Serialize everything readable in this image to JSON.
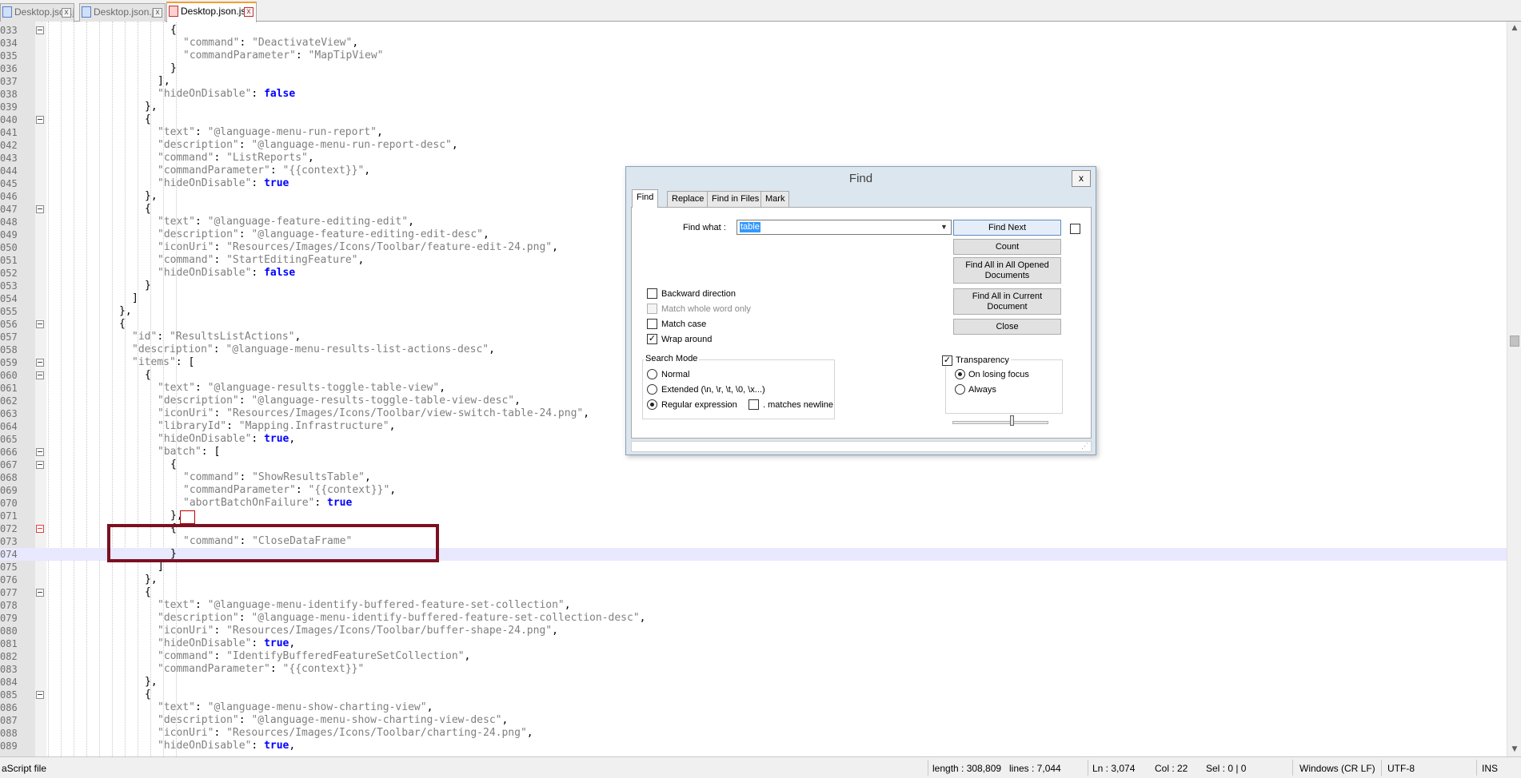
{
  "tabs": [
    {
      "label": "Desktop.json.js",
      "active": false
    },
    {
      "label": "Desktop.json.js",
      "active": false
    },
    {
      "label": "Desktop.json.js",
      "active": true
    }
  ],
  "tab_close_glyph": "x",
  "editor": {
    "current_line": "074",
    "lines": [
      {
        "n": "033",
        "fold": true,
        "parts": [
          {
            "t": "{",
            "c": "p"
          }
        ]
      },
      {
        "n": "034",
        "parts": [
          {
            "t": "\"command\"",
            "c": "s"
          },
          {
            "t": ": ",
            "c": "p"
          },
          {
            "t": "\"DeactivateView\"",
            "c": "s"
          },
          {
            "t": ",",
            "c": "p"
          }
        ]
      },
      {
        "n": "035",
        "parts": [
          {
            "t": "\"commandParameter\"",
            "c": "s"
          },
          {
            "t": ": ",
            "c": "p"
          },
          {
            "t": "\"MapTipView\"",
            "c": "s"
          }
        ]
      },
      {
        "n": "036",
        "parts": [
          {
            "t": "}",
            "c": "p"
          }
        ]
      },
      {
        "n": "037",
        "parts": [
          {
            "t": "],",
            "c": "p"
          }
        ]
      },
      {
        "n": "038",
        "parts": [
          {
            "t": "\"hideOnDisable\"",
            "c": "s"
          },
          {
            "t": ": ",
            "c": "p"
          },
          {
            "t": "false",
            "c": "k"
          }
        ]
      },
      {
        "n": "039",
        "parts": [
          {
            "t": "},",
            "c": "p"
          }
        ]
      },
      {
        "n": "040",
        "fold": true,
        "parts": [
          {
            "t": "{",
            "c": "p"
          }
        ]
      },
      {
        "n": "041",
        "parts": [
          {
            "t": "\"text\"",
            "c": "s"
          },
          {
            "t": ": ",
            "c": "p"
          },
          {
            "t": "\"@language-menu-run-report\"",
            "c": "s"
          },
          {
            "t": ",",
            "c": "p"
          }
        ]
      },
      {
        "n": "042",
        "parts": [
          {
            "t": "\"description\"",
            "c": "s"
          },
          {
            "t": ": ",
            "c": "p"
          },
          {
            "t": "\"@language-menu-run-report-desc\"",
            "c": "s"
          },
          {
            "t": ",",
            "c": "p"
          }
        ]
      },
      {
        "n": "043",
        "parts": [
          {
            "t": "\"command\"",
            "c": "s"
          },
          {
            "t": ": ",
            "c": "p"
          },
          {
            "t": "\"ListReports\"",
            "c": "s"
          },
          {
            "t": ",",
            "c": "p"
          }
        ]
      },
      {
        "n": "044",
        "parts": [
          {
            "t": "\"commandParameter\"",
            "c": "s"
          },
          {
            "t": ": ",
            "c": "p"
          },
          {
            "t": "\"{{context}}\"",
            "c": "s"
          },
          {
            "t": ",",
            "c": "p"
          }
        ]
      },
      {
        "n": "045",
        "parts": [
          {
            "t": "\"hideOnDisable\"",
            "c": "s"
          },
          {
            "t": ": ",
            "c": "p"
          },
          {
            "t": "true",
            "c": "k"
          }
        ]
      },
      {
        "n": "046",
        "parts": [
          {
            "t": "},",
            "c": "p"
          }
        ]
      },
      {
        "n": "047",
        "fold": true,
        "parts": [
          {
            "t": "{",
            "c": "p"
          }
        ]
      },
      {
        "n": "048",
        "parts": [
          {
            "t": "\"text\"",
            "c": "s"
          },
          {
            "t": ": ",
            "c": "p"
          },
          {
            "t": "\"@language-feature-editing-edit\"",
            "c": "s"
          },
          {
            "t": ",",
            "c": "p"
          }
        ]
      },
      {
        "n": "049",
        "parts": [
          {
            "t": "\"description\"",
            "c": "s"
          },
          {
            "t": ": ",
            "c": "p"
          },
          {
            "t": "\"@language-feature-editing-edit-desc\"",
            "c": "s"
          },
          {
            "t": ",",
            "c": "p"
          }
        ]
      },
      {
        "n": "050",
        "parts": [
          {
            "t": "\"iconUri\"",
            "c": "s"
          },
          {
            "t": ": ",
            "c": "p"
          },
          {
            "t": "\"Resources/Images/Icons/Toolbar/feature-edit-24.png\"",
            "c": "s"
          },
          {
            "t": ",",
            "c": "p"
          }
        ]
      },
      {
        "n": "051",
        "parts": [
          {
            "t": "\"command\"",
            "c": "s"
          },
          {
            "t": ": ",
            "c": "p"
          },
          {
            "t": "\"StartEditingFeature\"",
            "c": "s"
          },
          {
            "t": ",",
            "c": "p"
          }
        ]
      },
      {
        "n": "052",
        "parts": [
          {
            "t": "\"hideOnDisable\"",
            "c": "s"
          },
          {
            "t": ": ",
            "c": "p"
          },
          {
            "t": "false",
            "c": "k"
          }
        ]
      },
      {
        "n": "053",
        "parts": [
          {
            "t": "}",
            "c": "p"
          }
        ]
      },
      {
        "n": "054",
        "parts": [
          {
            "t": "]",
            "c": "p"
          }
        ]
      },
      {
        "n": "055",
        "parts": [
          {
            "t": "},",
            "c": "p"
          }
        ]
      },
      {
        "n": "056",
        "fold": true,
        "parts": [
          {
            "t": "{",
            "c": "p"
          }
        ]
      },
      {
        "n": "057",
        "parts": [
          {
            "t": "\"id\"",
            "c": "s"
          },
          {
            "t": ": ",
            "c": "p"
          },
          {
            "t": "\"ResultsListActions\"",
            "c": "s"
          },
          {
            "t": ",",
            "c": "p"
          }
        ]
      },
      {
        "n": "058",
        "parts": [
          {
            "t": "\"description\"",
            "c": "s"
          },
          {
            "t": ": ",
            "c": "p"
          },
          {
            "t": "\"@language-menu-results-list-actions-desc\"",
            "c": "s"
          },
          {
            "t": ",",
            "c": "p"
          }
        ]
      },
      {
        "n": "059",
        "fold": true,
        "parts": [
          {
            "t": "\"items\"",
            "c": "s"
          },
          {
            "t": ": [",
            "c": "p"
          }
        ]
      },
      {
        "n": "060",
        "fold": true,
        "parts": [
          {
            "t": "{",
            "c": "p"
          }
        ]
      },
      {
        "n": "061",
        "parts": [
          {
            "t": "\"text\"",
            "c": "s"
          },
          {
            "t": ": ",
            "c": "p"
          },
          {
            "t": "\"@language-results-toggle-table-view\"",
            "c": "s"
          },
          {
            "t": ",",
            "c": "p"
          }
        ]
      },
      {
        "n": "062",
        "parts": [
          {
            "t": "\"description\"",
            "c": "s"
          },
          {
            "t": ": ",
            "c": "p"
          },
          {
            "t": "\"@language-results-toggle-table-view-desc\"",
            "c": "s"
          },
          {
            "t": ",",
            "c": "p"
          }
        ]
      },
      {
        "n": "063",
        "parts": [
          {
            "t": "\"iconUri\"",
            "c": "s"
          },
          {
            "t": ": ",
            "c": "p"
          },
          {
            "t": "\"Resources/Images/Icons/Toolbar/view-switch-table-24.png\"",
            "c": "s"
          },
          {
            "t": ",",
            "c": "p"
          }
        ]
      },
      {
        "n": "064",
        "parts": [
          {
            "t": "\"libraryId\"",
            "c": "s"
          },
          {
            "t": ": ",
            "c": "p"
          },
          {
            "t": "\"Mapping.Infrastructure\"",
            "c": "s"
          },
          {
            "t": ",",
            "c": "p"
          }
        ]
      },
      {
        "n": "065",
        "parts": [
          {
            "t": "\"hideOnDisable\"",
            "c": "s"
          },
          {
            "t": ": ",
            "c": "p"
          },
          {
            "t": "true",
            "c": "k"
          },
          {
            "t": ",",
            "c": "p"
          }
        ]
      },
      {
        "n": "066",
        "fold": true,
        "parts": [
          {
            "t": "\"batch\"",
            "c": "s"
          },
          {
            "t": ": [",
            "c": "p"
          }
        ]
      },
      {
        "n": "067",
        "fold": true,
        "parts": [
          {
            "t": "{",
            "c": "p"
          }
        ]
      },
      {
        "n": "068",
        "parts": [
          {
            "t": "\"command\"",
            "c": "s"
          },
          {
            "t": ": ",
            "c": "p"
          },
          {
            "t": "\"ShowResultsTable\"",
            "c": "s"
          },
          {
            "t": ",",
            "c": "p"
          }
        ]
      },
      {
        "n": "069",
        "parts": [
          {
            "t": "\"commandParameter\"",
            "c": "s"
          },
          {
            "t": ": ",
            "c": "p"
          },
          {
            "t": "\"{{context}}\"",
            "c": "s"
          },
          {
            "t": ",",
            "c": "p"
          }
        ]
      },
      {
        "n": "070",
        "parts": [
          {
            "t": "\"abortBatchOnFailure\"",
            "c": "s"
          },
          {
            "t": ": ",
            "c": "p"
          },
          {
            "t": "true",
            "c": "k"
          }
        ]
      },
      {
        "n": "071",
        "parts": [
          {
            "t": "},",
            "c": "p"
          }
        ]
      },
      {
        "n": "072",
        "fold": true,
        "fold_red": true,
        "parts": [
          {
            "t": "{",
            "c": "p"
          }
        ]
      },
      {
        "n": "073",
        "parts": [
          {
            "t": "\"command\"",
            "c": "s"
          },
          {
            "t": ": ",
            "c": "p"
          },
          {
            "t": "\"CloseDataFrame\"",
            "c": "s"
          }
        ]
      },
      {
        "n": "074",
        "parts": [
          {
            "t": "}",
            "c": "p"
          }
        ]
      },
      {
        "n": "075",
        "parts": [
          {
            "t": "]",
            "c": "p"
          }
        ]
      },
      {
        "n": "076",
        "parts": [
          {
            "t": "},",
            "c": "p"
          }
        ]
      },
      {
        "n": "077",
        "fold": true,
        "parts": [
          {
            "t": "{",
            "c": "p"
          }
        ]
      },
      {
        "n": "078",
        "parts": [
          {
            "t": "\"text\"",
            "c": "s"
          },
          {
            "t": ": ",
            "c": "p"
          },
          {
            "t": "\"@language-menu-identify-buffered-feature-set-collection\"",
            "c": "s"
          },
          {
            "t": ",",
            "c": "p"
          }
        ]
      },
      {
        "n": "079",
        "parts": [
          {
            "t": "\"description\"",
            "c": "s"
          },
          {
            "t": ": ",
            "c": "p"
          },
          {
            "t": "\"@language-menu-identify-buffered-feature-set-collection-desc\"",
            "c": "s"
          },
          {
            "t": ",",
            "c": "p"
          }
        ]
      },
      {
        "n": "080",
        "parts": [
          {
            "t": "\"iconUri\"",
            "c": "s"
          },
          {
            "t": ": ",
            "c": "p"
          },
          {
            "t": "\"Resources/Images/Icons/Toolbar/buffer-shape-24.png\"",
            "c": "s"
          },
          {
            "t": ",",
            "c": "p"
          }
        ]
      },
      {
        "n": "081",
        "parts": [
          {
            "t": "\"hideOnDisable\"",
            "c": "s"
          },
          {
            "t": ": ",
            "c": "p"
          },
          {
            "t": "true",
            "c": "k"
          },
          {
            "t": ",",
            "c": "p"
          }
        ]
      },
      {
        "n": "082",
        "parts": [
          {
            "t": "\"command\"",
            "c": "s"
          },
          {
            "t": ": ",
            "c": "p"
          },
          {
            "t": "\"IdentifyBufferedFeatureSetCollection\"",
            "c": "s"
          },
          {
            "t": ",",
            "c": "p"
          }
        ]
      },
      {
        "n": "083",
        "parts": [
          {
            "t": "\"commandParameter\"",
            "c": "s"
          },
          {
            "t": ": ",
            "c": "p"
          },
          {
            "t": "\"{{context}}\"",
            "c": "s"
          }
        ]
      },
      {
        "n": "084",
        "parts": [
          {
            "t": "},",
            "c": "p"
          }
        ]
      },
      {
        "n": "085",
        "fold": true,
        "parts": [
          {
            "t": "{",
            "c": "p"
          }
        ]
      },
      {
        "n": "086",
        "parts": [
          {
            "t": "\"text\"",
            "c": "s"
          },
          {
            "t": ": ",
            "c": "p"
          },
          {
            "t": "\"@language-menu-show-charting-view\"",
            "c": "s"
          },
          {
            "t": ",",
            "c": "p"
          }
        ]
      },
      {
        "n": "087",
        "parts": [
          {
            "t": "\"description\"",
            "c": "s"
          },
          {
            "t": ": ",
            "c": "p"
          },
          {
            "t": "\"@language-menu-show-charting-view-desc\"",
            "c": "s"
          },
          {
            "t": ",",
            "c": "p"
          }
        ]
      },
      {
        "n": "088",
        "parts": [
          {
            "t": "\"iconUri\"",
            "c": "s"
          },
          {
            "t": ": ",
            "c": "p"
          },
          {
            "t": "\"Resources/Images/Icons/Toolbar/charting-24.png\"",
            "c": "s"
          },
          {
            "t": ",",
            "c": "p"
          }
        ]
      },
      {
        "n": "089",
        "parts": [
          {
            "t": "\"hideOnDisable\"",
            "c": "s"
          },
          {
            "t": ": ",
            "c": "p"
          },
          {
            "t": "true",
            "c": "k"
          },
          {
            "t": ",",
            "c": "p"
          }
        ]
      }
    ]
  },
  "status": {
    "file_type": "aScript file",
    "length": "length : 308,809",
    "lines": "lines : 7,044",
    "ln": "Ln : 3,074",
    "col": "Col : 22",
    "sel": "Sel : 0 | 0",
    "eol": "Windows (CR LF)",
    "encoding": "UTF-8",
    "mode": "INS"
  },
  "find_dialog": {
    "title": "Find",
    "close_glyph": "x",
    "tabs": [
      "Find",
      "Replace",
      "Find in Files",
      "Mark"
    ],
    "find_what_label": "Find what :",
    "find_what_value": "table",
    "buttons": {
      "find_next": "Find Next",
      "count": "Count",
      "find_all_opened": "Find All in All Opened Documents",
      "find_all_current": "Find All in Current Document",
      "close": "Close"
    },
    "options": {
      "backward": "Backward direction",
      "whole_word": "Match whole word only",
      "match_case": "Match case",
      "wrap_around": "Wrap around"
    },
    "search_mode": {
      "title": "Search Mode",
      "normal": "Normal",
      "extended": "Extended (\\n, \\r, \\t, \\0, \\x...)",
      "regex": "Regular expression",
      "matches_newline": ". matches newline",
      "selected": "regex"
    },
    "transparency": {
      "title": "Transparency",
      "on_losing_focus": "On losing focus",
      "always": "Always",
      "level_fraction": 0.6
    }
  },
  "colors": {
    "keyword": "#0000ff",
    "string": "#808080",
    "current_line": "#e8e8ff",
    "highlight_frame": "#7b1020",
    "active_tab_accent": "#f0a030"
  }
}
